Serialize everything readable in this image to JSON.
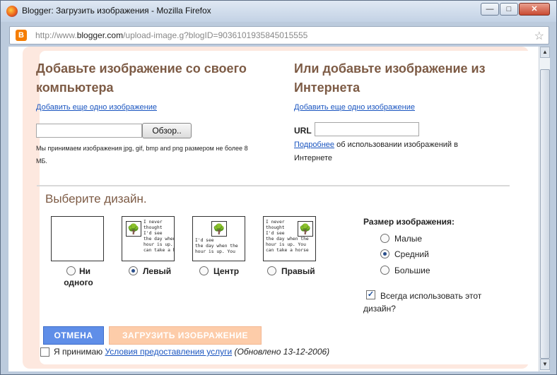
{
  "window": {
    "title": "Blogger: Загрузить изображения - Mozilla Firefox",
    "url_prefix": "http://www.",
    "url_domain": "blogger.com",
    "url_suffix": "/upload-image.g?blogID=9036101935845015555"
  },
  "left_section": {
    "heading_line1": "Добавьте изображение со своего",
    "heading_line2": "компьютера",
    "add_more_link": "Добавить еще одно изображение",
    "browse_button": "Обзор..",
    "file_value": "",
    "note_line1": "Мы принимаем изображения jpg, gif, bmp and png размером не более 8",
    "note_line2": "МБ."
  },
  "right_section": {
    "heading_line1": "Или добавьте изображение из",
    "heading_line2": "Интернета",
    "add_more_link": "Добавить еще одно изображение",
    "url_label": "URL",
    "url_value": "",
    "more_link": "Подробнее",
    "info_rest_line1": " об использовании изображений в",
    "info_line2": "Интернете"
  },
  "layout": {
    "heading": "Выберите дизайн.",
    "sample_text": "I never\nthought\nI'd see\nthe day when the\nhour is up. You\ncan take a horse",
    "options": [
      {
        "label_line1": "Ни",
        "label_line2": "одного",
        "selected": false
      },
      {
        "label": "Левый",
        "selected": true
      },
      {
        "label": "Центр",
        "selected": false
      },
      {
        "label": "Правый",
        "selected": false
      }
    ]
  },
  "size": {
    "title": "Размер изображения:",
    "options": [
      {
        "label": "Малые",
        "selected": false
      },
      {
        "label": "Средний",
        "selected": true
      },
      {
        "label": "Большие",
        "selected": false
      }
    ],
    "always_use_line1": "Всегда использовать этот",
    "always_use_line2": "дизайн?",
    "always_use_checked": true
  },
  "actions": {
    "cancel": "ОТМЕНА",
    "upload": "ЗАГРУЗИТЬ ИЗОБРАЖЕНИЕ"
  },
  "terms": {
    "prefix": "Я принимаю ",
    "link": "Условия предоставления услуги",
    "suffix": " (Обновлено 13-12-2006)",
    "checked": false
  },
  "icons": {
    "browser": "firefox-icon",
    "site": "blogger-icon",
    "bookmark": "star-icon",
    "picture": "tree-picture-icon"
  },
  "colors": {
    "heading": "#7d5b45",
    "link": "#1a55c0",
    "cancel_button": "#5f8ee8",
    "upload_button": "#fdcca9",
    "panel_border": "#fde8df"
  }
}
